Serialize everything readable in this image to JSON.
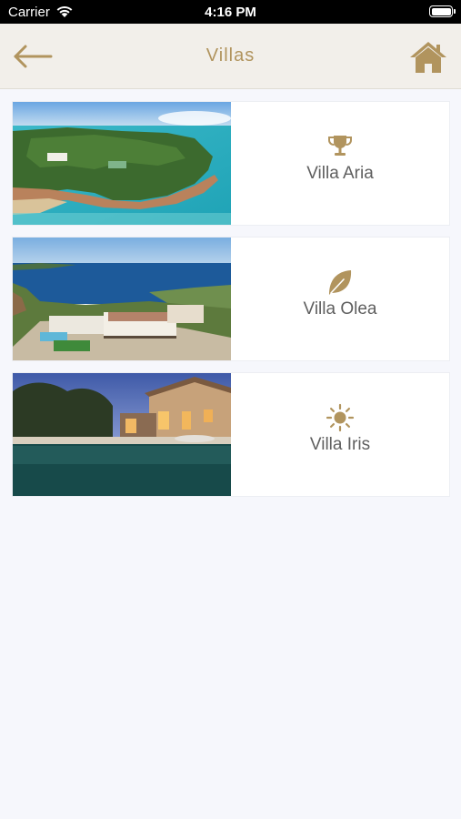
{
  "status_bar": {
    "carrier": "Carrier",
    "time": "4:16 PM"
  },
  "navbar": {
    "title": "Villas",
    "back_icon": "arrow-left-icon",
    "home_icon": "home-icon"
  },
  "accent_color": "#b1945e",
  "villas": [
    {
      "name": "Villa Aria",
      "icon": "trophy-icon"
    },
    {
      "name": "Villa Olea",
      "icon": "leaf-icon"
    },
    {
      "name": "Villa Iris",
      "icon": "sun-icon"
    }
  ]
}
